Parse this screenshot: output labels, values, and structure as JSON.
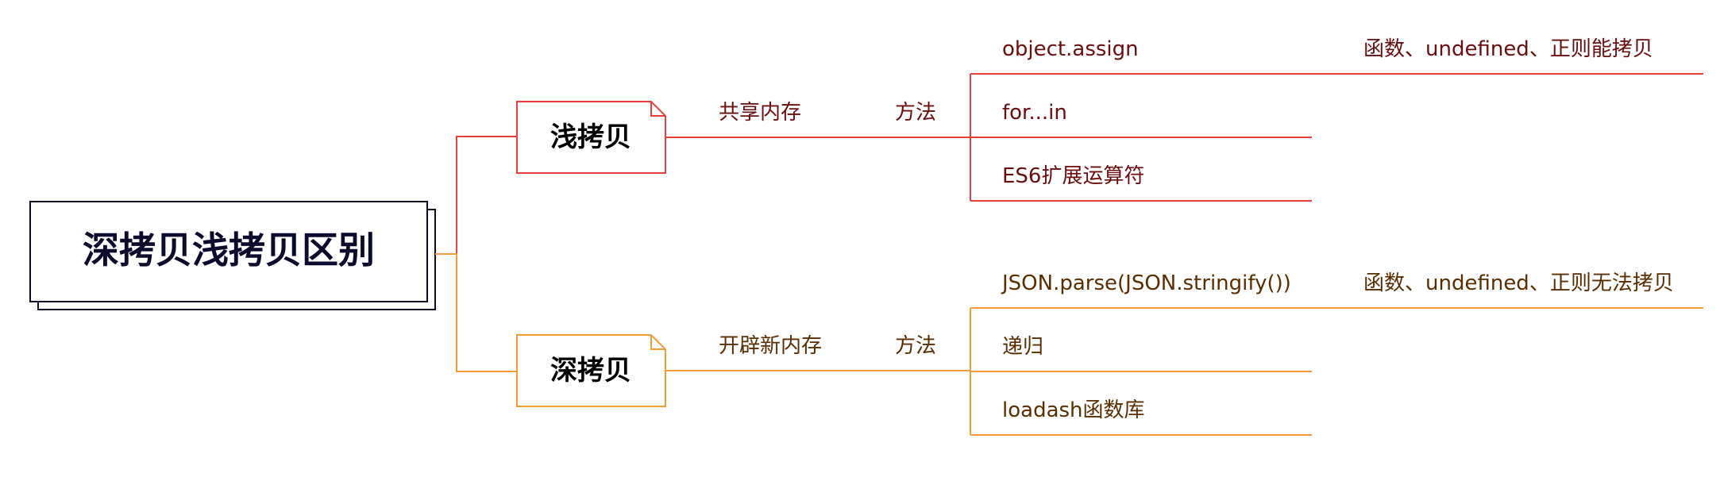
{
  "colors": {
    "background": "#ffffff",
    "root_border": "#0b0b2e",
    "root_text": "#0b0b2e",
    "shallow_line": "#e8413c",
    "deep_line": "#f39a3a",
    "branch_text": "#000000",
    "shallow_leaf_text": "#6b0d0d",
    "deep_leaf_text": "#5a2e00"
  },
  "root": {
    "label": "深拷贝浅拷贝区别"
  },
  "branches": [
    {
      "id": "shallow",
      "label": "浅拷贝",
      "memory_label": "共享内存",
      "method_label": "方法",
      "methods": [
        {
          "label": "object.assign",
          "note": "函数、undefined、正则能拷贝"
        },
        {
          "label": "for...in",
          "note": ""
        },
        {
          "label": "ES6扩展运算符",
          "note": ""
        }
      ]
    },
    {
      "id": "deep",
      "label": "深拷贝",
      "memory_label": "开辟新内存",
      "method_label": "方法",
      "methods": [
        {
          "label": "JSON.parse(JSON.stringify())",
          "note": "函数、undefined、正则无法拷贝"
        },
        {
          "label": "递归",
          "note": ""
        },
        {
          "label": "loadash函数库",
          "note": ""
        }
      ]
    }
  ]
}
